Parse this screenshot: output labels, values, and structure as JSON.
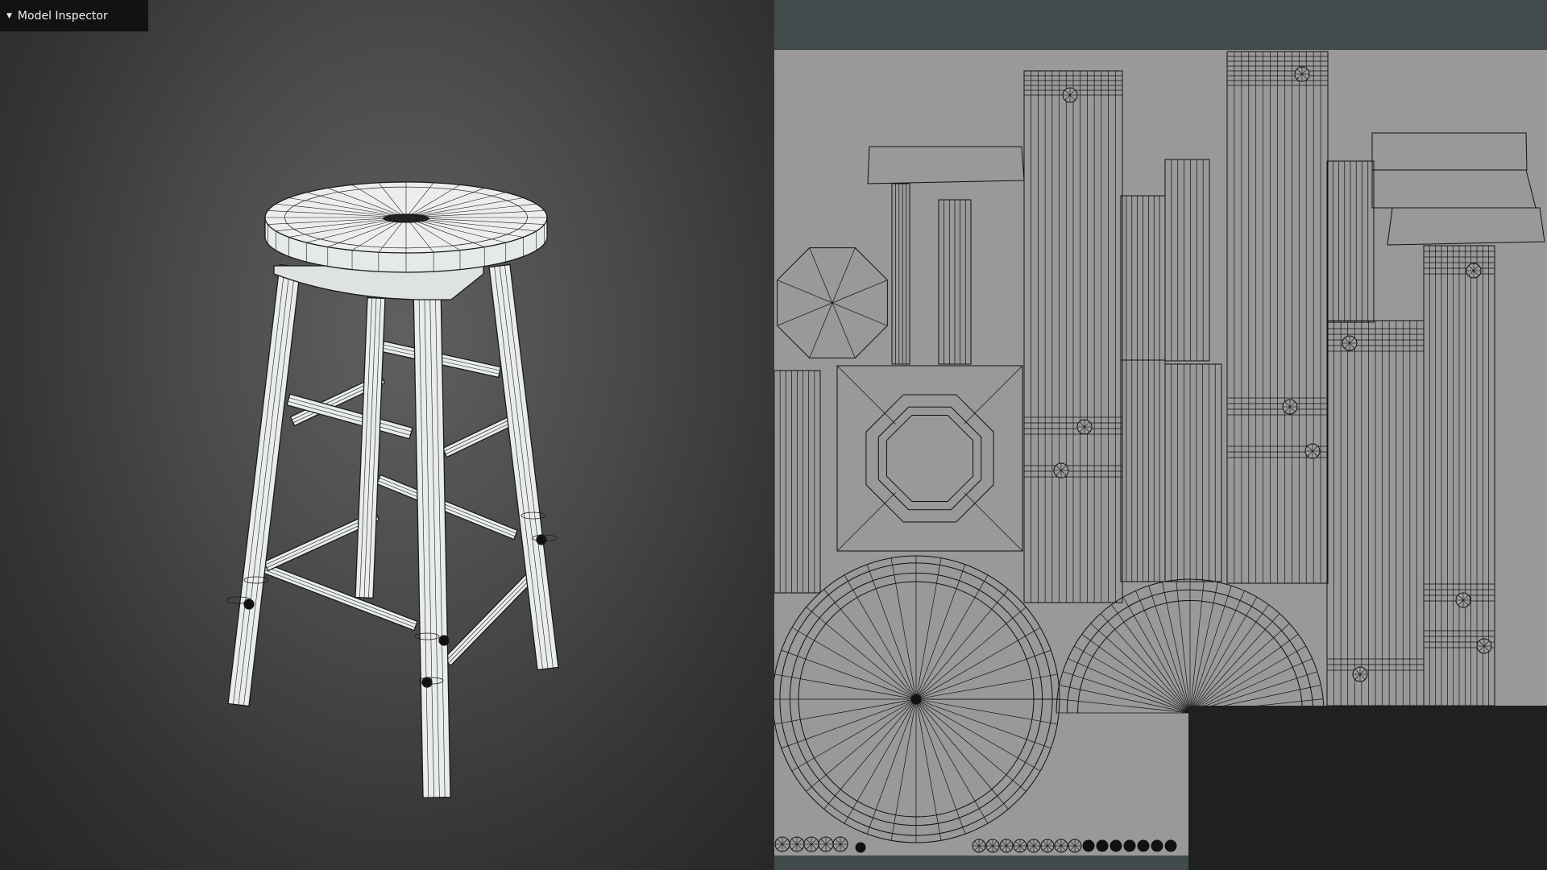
{
  "panel": {
    "title": "Model Inspector",
    "expanded": true,
    "toggle_icon": "caret-down-icon"
  },
  "viewport": {
    "object": "bar-stool-wireframe",
    "render_mode": "wireframe"
  },
  "uv_editor": {
    "layout": "uv-islands",
    "background_color": "#999999",
    "frame_color": "#424b4b",
    "line_color": "#111111"
  }
}
